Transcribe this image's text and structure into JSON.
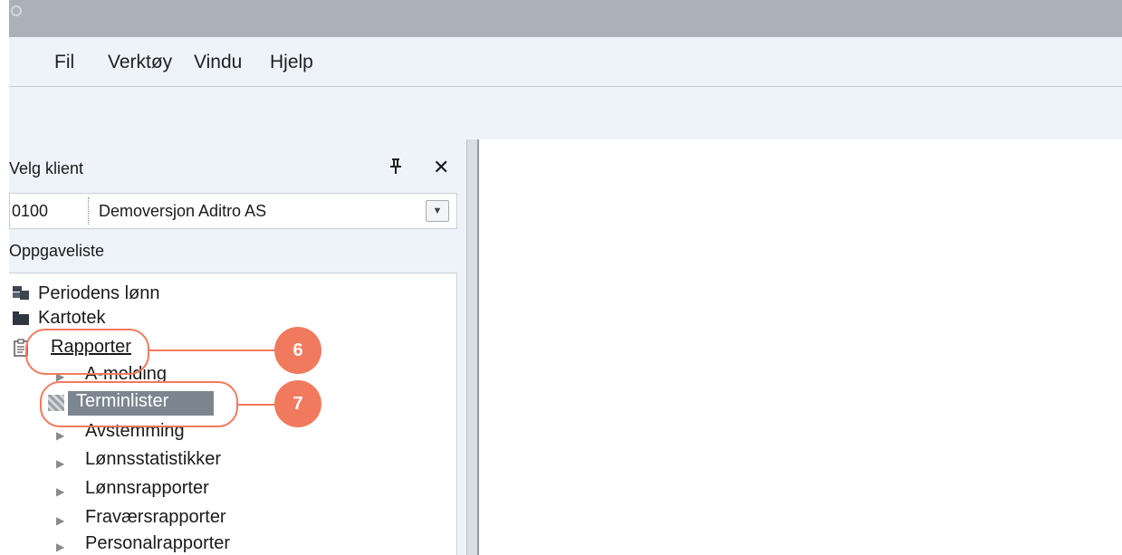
{
  "menu": {
    "items": [
      {
        "label": "Fil"
      },
      {
        "label": "Verktøy"
      },
      {
        "label": "Vindu"
      },
      {
        "label": "Hjelp"
      }
    ]
  },
  "client_panel": {
    "title": "Velg klient",
    "pin_icon": "pin-icon",
    "close_icon": "close-icon",
    "client_code": "0100",
    "client_name": "Demoversjon Aditro AS"
  },
  "task_list": {
    "title": "Oppgaveliste",
    "items": [
      {
        "label": "Periodens lønn",
        "icon": "payroll-icon"
      },
      {
        "label": "Kartotek",
        "icon": "folder-icon"
      },
      {
        "label": "Rapporter",
        "icon": "reports-icon"
      }
    ],
    "reports_children": [
      {
        "label": "A-melding"
      },
      {
        "label": "Terminlister",
        "selected": true
      },
      {
        "label": "Avstemming"
      },
      {
        "label": "Lønnsstatistikker"
      },
      {
        "label": "Lønnsrapporter"
      },
      {
        "label": "Fraværsrapporter"
      },
      {
        "label": "Personalrapporter"
      }
    ]
  },
  "callouts": [
    {
      "number": "6"
    },
    {
      "number": "7"
    }
  ],
  "colors": {
    "callout": "#f17a5e",
    "selection": "#7b8691",
    "panel_bg": "#eef3f9"
  }
}
